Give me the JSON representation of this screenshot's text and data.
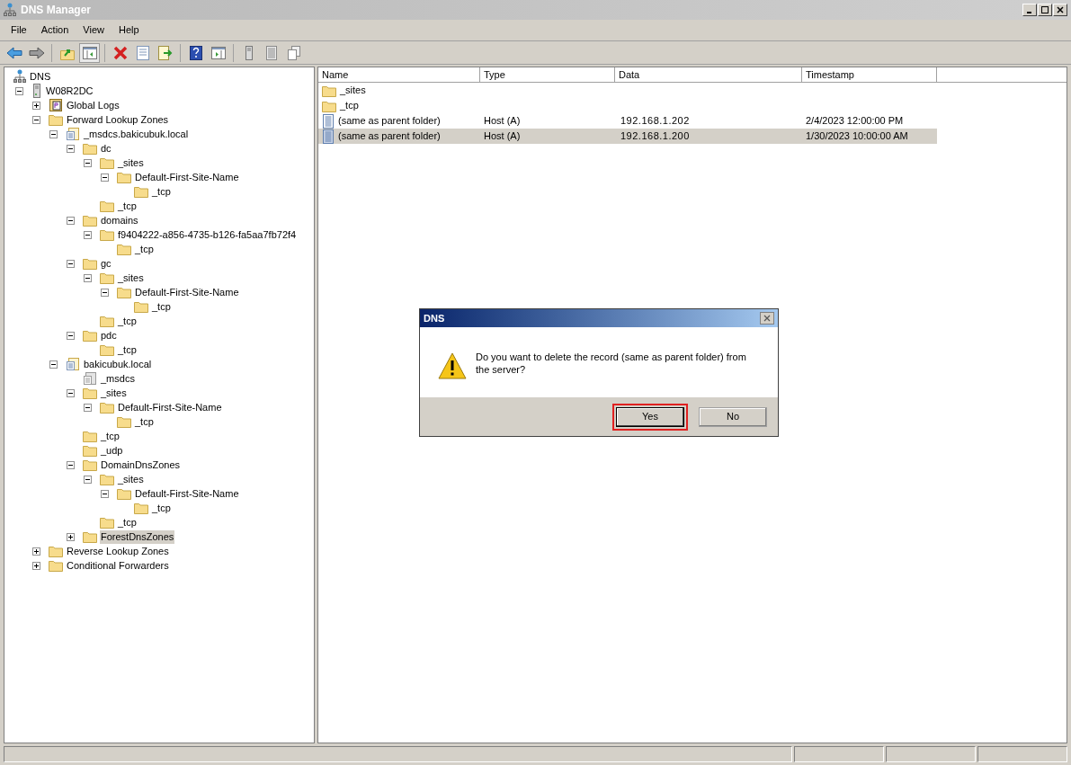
{
  "window": {
    "title": "DNS Manager"
  },
  "menu": [
    "File",
    "Action",
    "View",
    "Help"
  ],
  "toolbar": [
    {
      "kind": "back"
    },
    {
      "kind": "forward"
    },
    {
      "kind": "sep"
    },
    {
      "kind": "up"
    },
    {
      "kind": "pane",
      "selected": true
    },
    {
      "kind": "sep"
    },
    {
      "kind": "delete"
    },
    {
      "kind": "properties"
    },
    {
      "kind": "export"
    },
    {
      "kind": "sep"
    },
    {
      "kind": "help"
    },
    {
      "kind": "view"
    },
    {
      "kind": "sep"
    },
    {
      "kind": "server"
    },
    {
      "kind": "list"
    },
    {
      "kind": "copy"
    }
  ],
  "tree": [
    {
      "label": "DNS",
      "kind": "dns",
      "selected": false,
      "children": [
        {
          "label": "W08R2DC",
          "kind": "server",
          "expanded": true,
          "selected": false,
          "children": [
            {
              "label": "Global Logs",
              "kind": "log",
              "expanded": false,
              "selected": false
            },
            {
              "label": "Forward Lookup Zones",
              "kind": "folder",
              "expanded": true,
              "selected": false,
              "children": [
                {
                  "label": "_msdcs.bakicubuk.local",
                  "kind": "zone",
                  "expanded": true,
                  "selected": false,
                  "children": [
                    {
                      "label": "dc",
                      "kind": "folder",
                      "expanded": true,
                      "selected": false,
                      "children": [
                        {
                          "label": "_sites",
                          "kind": "folder",
                          "expanded": true,
                          "selected": false,
                          "children": [
                            {
                              "label": "Default-First-Site-Name",
                              "kind": "folder",
                              "expanded": true,
                              "selected": false,
                              "children": [
                                {
                                  "label": "_tcp",
                                  "kind": "folder",
                                  "selected": false
                                }
                              ]
                            }
                          ]
                        },
                        {
                          "label": "_tcp",
                          "kind": "folder",
                          "selected": false
                        }
                      ]
                    },
                    {
                      "label": "domains",
                      "kind": "folder",
                      "expanded": true,
                      "selected": false,
                      "children": [
                        {
                          "label": "f9404222-a856-4735-b126-fa5aa7fb72f4",
                          "kind": "folder",
                          "expanded": true,
                          "selected": false,
                          "children": [
                            {
                              "label": "_tcp",
                              "kind": "folder",
                              "selected": false
                            }
                          ]
                        }
                      ]
                    },
                    {
                      "label": "gc",
                      "kind": "folder",
                      "expanded": true,
                      "selected": false,
                      "children": [
                        {
                          "label": "_sites",
                          "kind": "folder",
                          "expanded": true,
                          "selected": false,
                          "children": [
                            {
                              "label": "Default-First-Site-Name",
                              "kind": "folder",
                              "expanded": true,
                              "selected": false,
                              "children": [
                                {
                                  "label": "_tcp",
                                  "kind": "folder",
                                  "selected": false
                                }
                              ]
                            }
                          ]
                        },
                        {
                          "label": "_tcp",
                          "kind": "folder",
                          "selected": false
                        }
                      ]
                    },
                    {
                      "label": "pdc",
                      "kind": "folder",
                      "expanded": true,
                      "selected": false,
                      "children": [
                        {
                          "label": "_tcp",
                          "kind": "folder",
                          "selected": false
                        }
                      ]
                    }
                  ]
                },
                {
                  "label": "bakicubuk.local",
                  "kind": "zone",
                  "expanded": true,
                  "selected": false,
                  "children": [
                    {
                      "label": "_msdcs",
                      "kind": "delegation",
                      "selected": false
                    },
                    {
                      "label": "_sites",
                      "kind": "folder",
                      "expanded": true,
                      "selected": false,
                      "children": [
                        {
                          "label": "Default-First-Site-Name",
                          "kind": "folder",
                          "expanded": true,
                          "selected": false,
                          "children": [
                            {
                              "label": "_tcp",
                              "kind": "folder",
                              "selected": false
                            }
                          ]
                        }
                      ]
                    },
                    {
                      "label": "_tcp",
                      "kind": "folder",
                      "selected": false
                    },
                    {
                      "label": "_udp",
                      "kind": "folder",
                      "selected": false
                    },
                    {
                      "label": "DomainDnsZones",
                      "kind": "folder",
                      "expanded": true,
                      "selected": false,
                      "children": [
                        {
                          "label": "_sites",
                          "kind": "folder",
                          "expanded": true,
                          "selected": false,
                          "children": [
                            {
                              "label": "Default-First-Site-Name",
                              "kind": "folder",
                              "expanded": true,
                              "selected": false,
                              "children": [
                                {
                                  "label": "_tcp",
                                  "kind": "folder",
                                  "selected": false
                                }
                              ]
                            }
                          ]
                        },
                        {
                          "label": "_tcp",
                          "kind": "folder",
                          "selected": false
                        }
                      ]
                    },
                    {
                      "label": "ForestDnsZones",
                      "kind": "folder",
                      "expanded": false,
                      "selected": true
                    }
                  ]
                }
              ]
            },
            {
              "label": "Reverse Lookup Zones",
              "kind": "folder",
              "expanded": false,
              "selected": false
            },
            {
              "label": "Conditional Forwarders",
              "kind": "folder",
              "expanded": false,
              "selected": false
            }
          ]
        }
      ]
    }
  ],
  "table": {
    "columns": [
      "Name",
      "Type",
      "Data",
      "Timestamp"
    ],
    "rows": [
      {
        "kind": "folder",
        "name": "_sites",
        "selected": false
      },
      {
        "kind": "folder",
        "name": "_tcp",
        "selected": false
      },
      {
        "kind": "record",
        "name": "(same as parent folder)",
        "type": "Host (A)",
        "data": "192.168.1.202",
        "timestamp": "2/4/2023 12:00:00 PM",
        "selected": false
      },
      {
        "kind": "record",
        "name": "(same as parent folder)",
        "type": "Host (A)",
        "data": "192.168.1.200",
        "timestamp": "1/30/2023 10:00:00 AM",
        "selected": true
      }
    ]
  },
  "dialog": {
    "title": "DNS",
    "message": "Do you want to delete the record (same as parent folder) from the server?",
    "buttons": [
      {
        "label": "Yes",
        "highlighted": true
      },
      {
        "label": "No",
        "highlighted": false
      }
    ]
  }
}
